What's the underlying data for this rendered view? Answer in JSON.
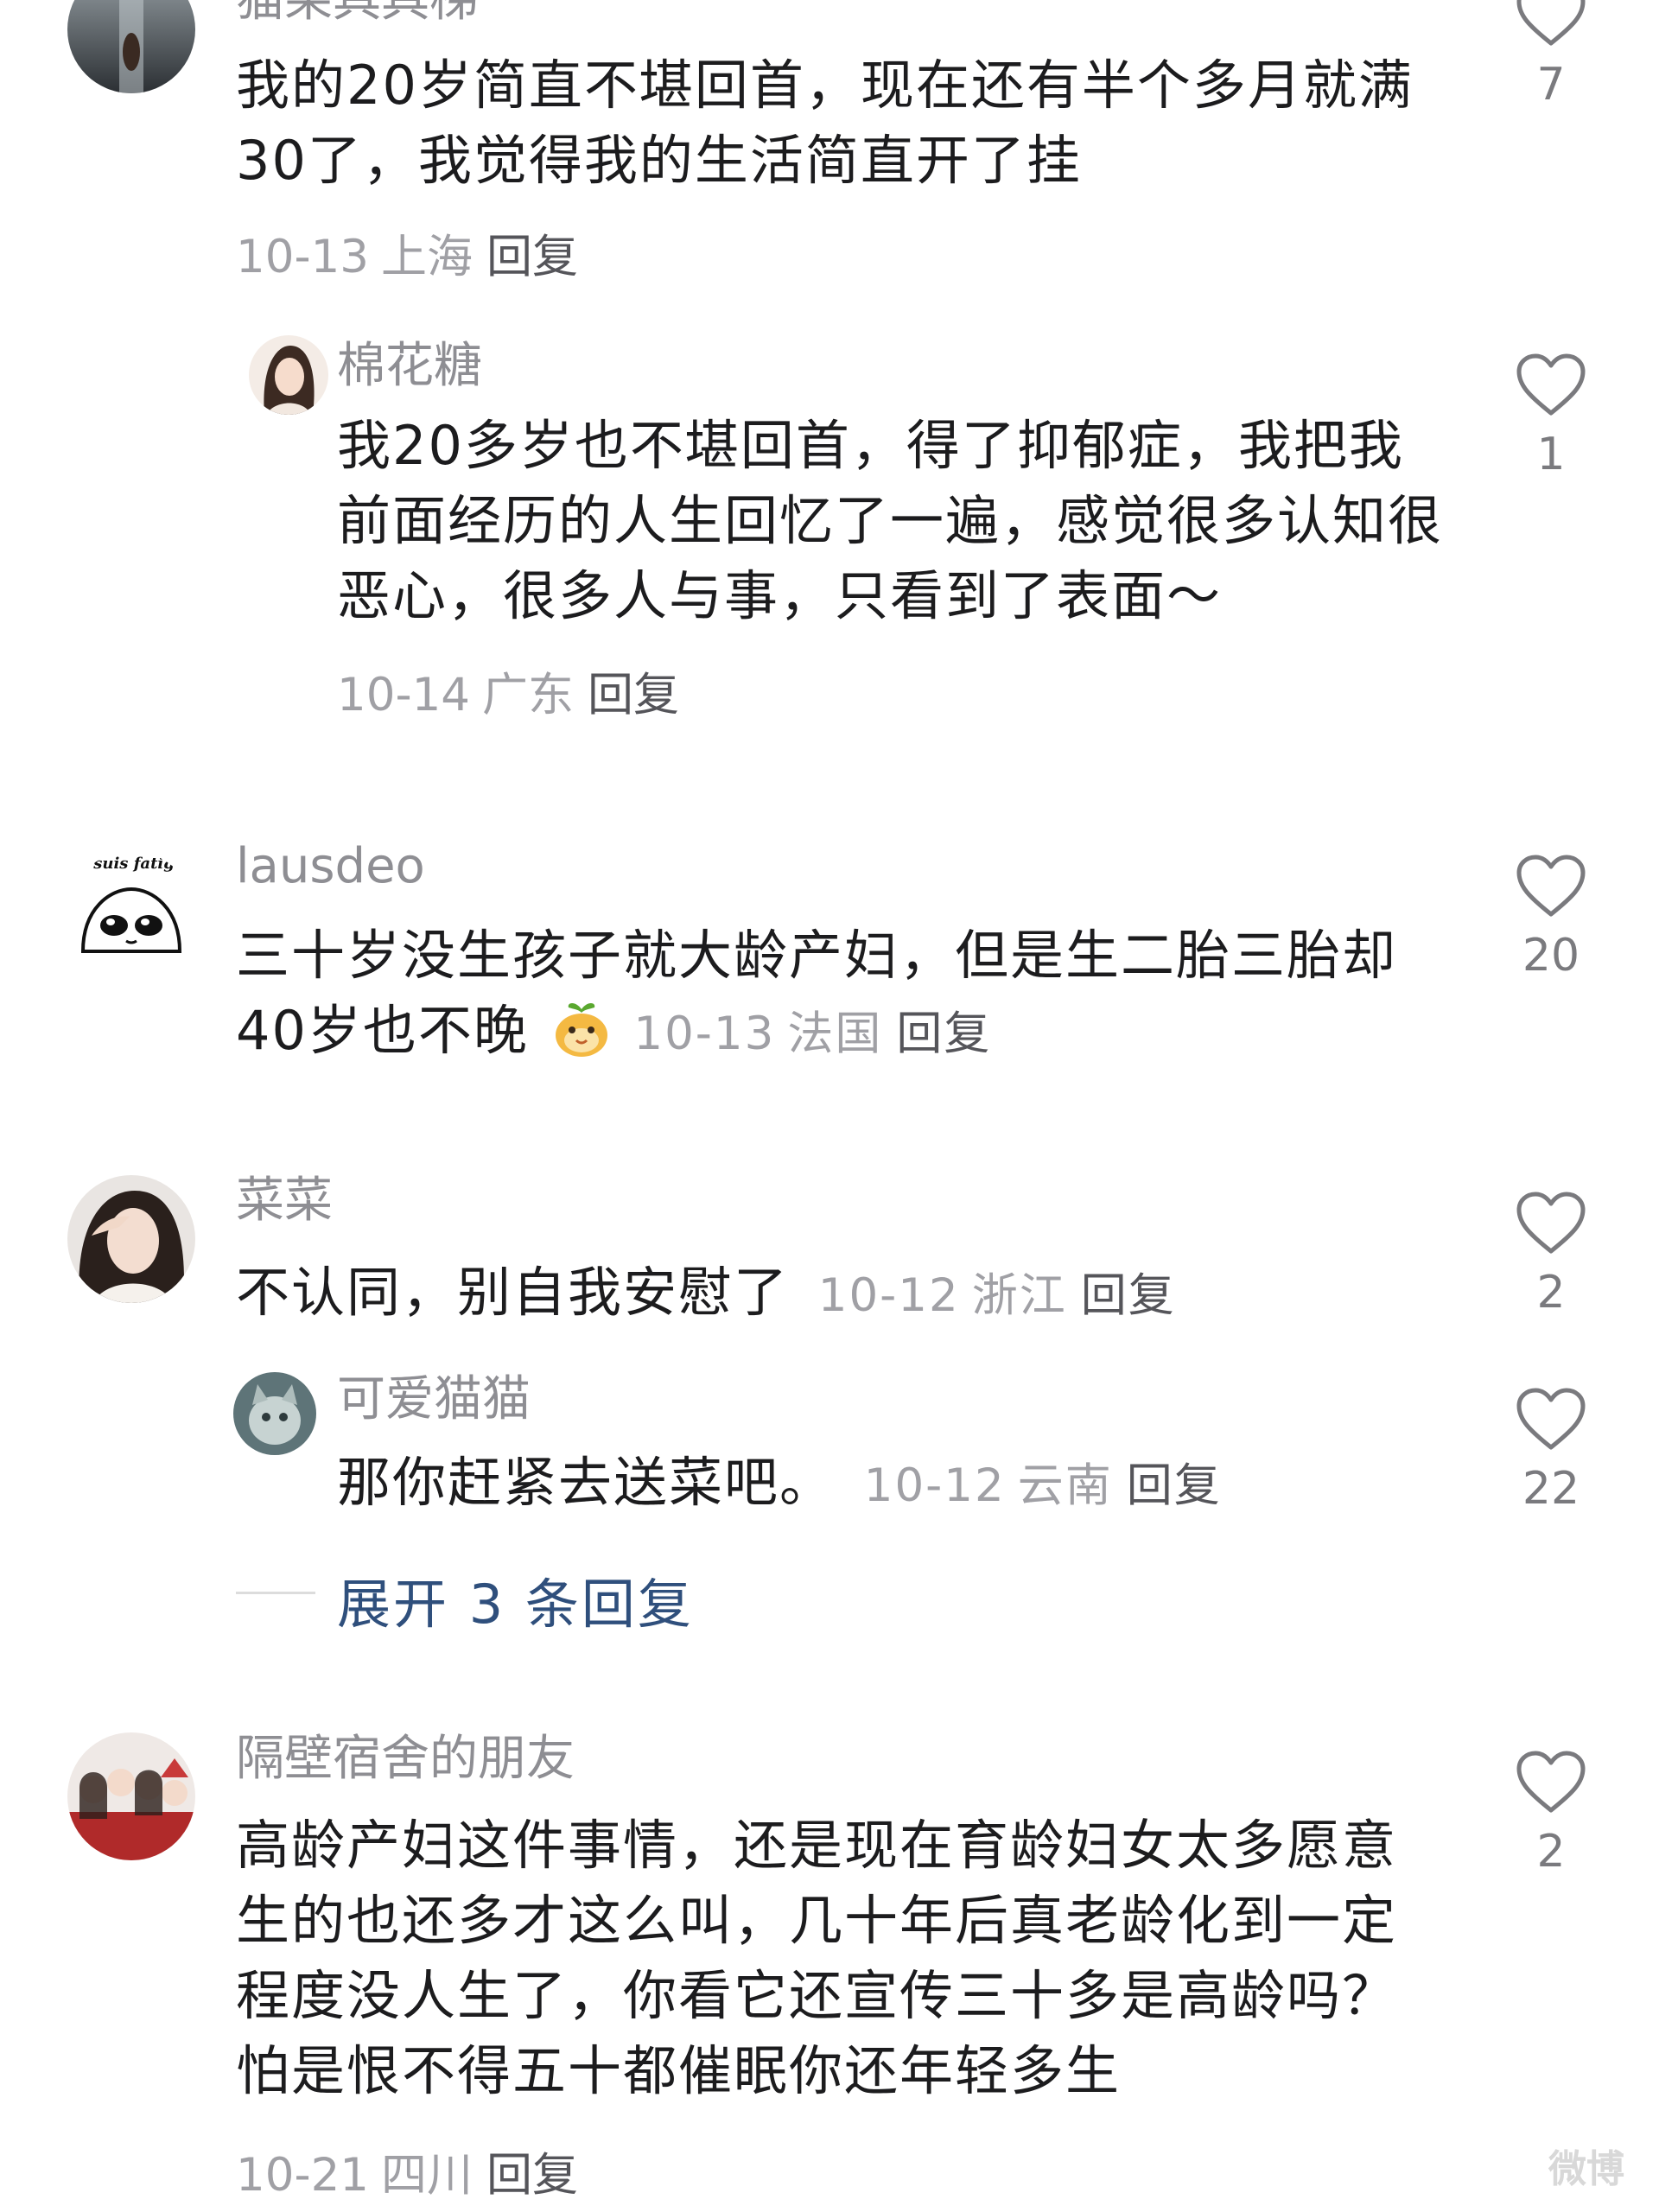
{
  "comments": [
    {
      "username": "猫果具具梯",
      "text": "我的20岁简直不堪回首，现在还有半个多月就满30了，我觉得我的生活简直开了挂",
      "date": "10-13",
      "region": "上海",
      "reply": "回复",
      "likes": "7"
    },
    {
      "username": "棉花糖",
      "text": "我20多岁也不堪回首，得了抑郁症，我把我前面经历的人生回忆了一遍，感觉很多认知很恶心，很多人与事，只看到了表面～",
      "date": "10-14",
      "region": "广东",
      "reply": "回复",
      "likes": "1"
    },
    {
      "username": "lausdeo",
      "avatar_text": "je suis fatigué",
      "text": "三十岁没生孩子就大龄产妇，但是生二胎三胎却40岁也不晚",
      "date": "10-13",
      "region": "法国",
      "reply": "回复",
      "likes": "20"
    },
    {
      "username": "菜菜",
      "text": "不认同，别自我安慰了",
      "date": "10-12",
      "region": "浙江",
      "reply": "回复",
      "likes": "2"
    },
    {
      "username": "可爱猫猫",
      "text": "那你赶紧去送菜吧。",
      "date": "10-12",
      "region": "云南",
      "reply": "回复",
      "likes": "22"
    },
    {
      "username": "隔壁宿舍的朋友",
      "text": "高龄产妇这件事情，还是现在育龄妇女太多愿意生的也还多才这么叫，几十年后真老龄化到一定程度没人生了，你看它还宣传三十多是高龄吗？怕是恨不得五十都催眠你还年轻多生",
      "date": "10-21",
      "region": "四川",
      "reply": "回复",
      "likes": "2"
    }
  ],
  "expand_replies": "展开 3 条回复",
  "watermark": "微博",
  "colors": {
    "username": "#8e8e93",
    "text": "#1c1c1e",
    "meta": "#a0a0a5",
    "link": "#2f4f7c",
    "heart": "#7a7a7e"
  },
  "icons": {
    "like": "heart-outline-icon",
    "emoji": "sprout-face-emoji-icon"
  }
}
